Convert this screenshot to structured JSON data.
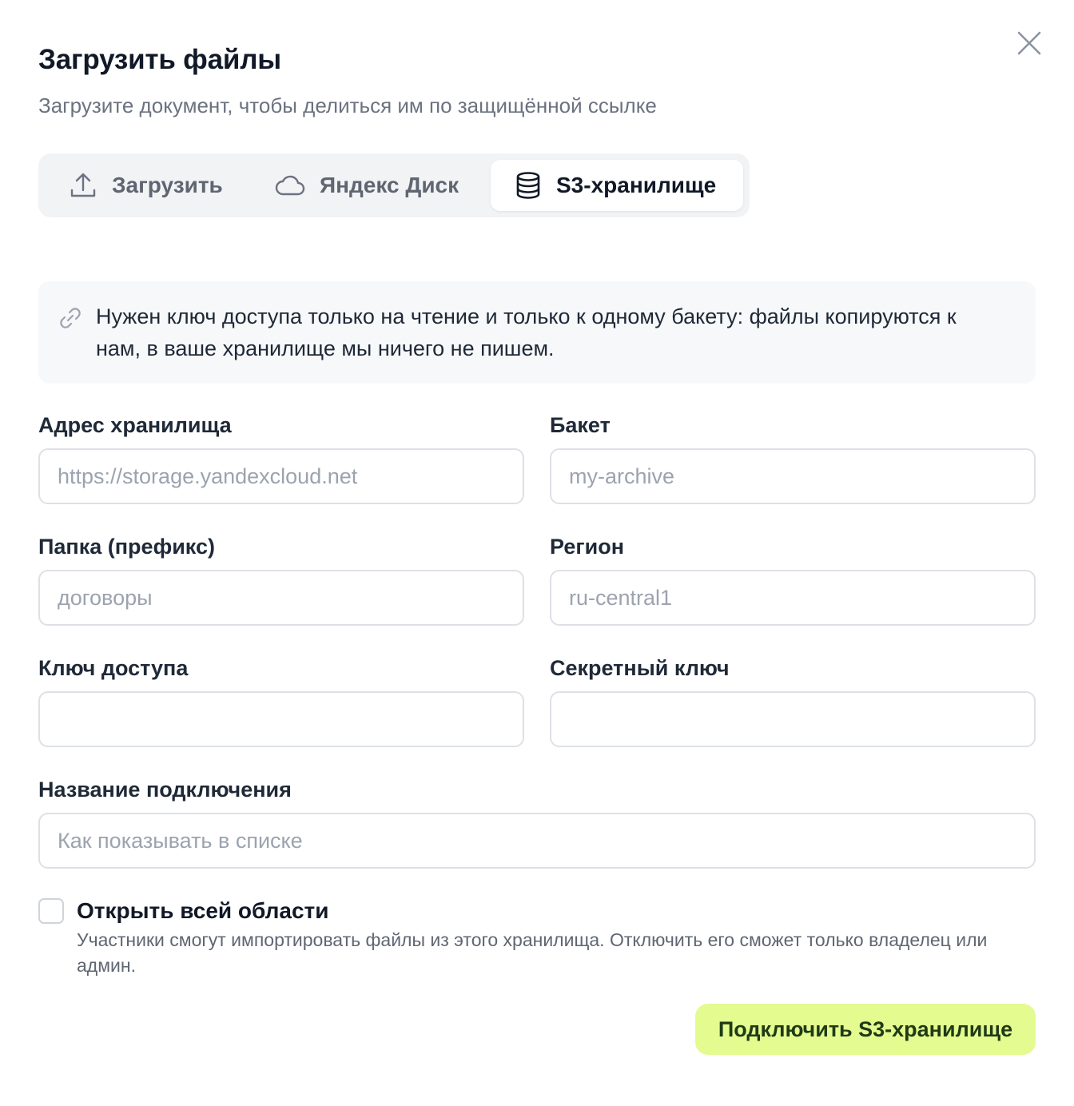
{
  "dialog": {
    "title": "Загрузить файлы",
    "subtitle": "Загрузите документ, чтобы делиться им по защищённой ссылке"
  },
  "tabs": [
    {
      "label": "Загрузить",
      "icon": "upload-icon",
      "active": false
    },
    {
      "label": "Яндекс Диск",
      "icon": "cloud-icon",
      "active": false
    },
    {
      "label": "S3-хранилище",
      "icon": "database-icon",
      "active": true
    }
  ],
  "info": {
    "icon": "link-icon",
    "text": "Нужен ключ доступа только на чтение и только к одному бакету: файлы копируются к нам, в ваше хранилище мы ничего не пишем."
  },
  "form": {
    "endpoint": {
      "label": "Адрес хранилища",
      "placeholder": "https://storage.yandexcloud.net",
      "value": ""
    },
    "bucket": {
      "label": "Бакет",
      "placeholder": "my-archive",
      "value": ""
    },
    "prefix": {
      "label": "Папка (префикс)",
      "placeholder": "договоры",
      "value": ""
    },
    "region": {
      "label": "Регион",
      "placeholder": "ru-central1",
      "value": ""
    },
    "access_key": {
      "label": "Ключ доступа",
      "placeholder": "",
      "value": ""
    },
    "secret_key": {
      "label": "Секретный ключ",
      "placeholder": "",
      "value": ""
    },
    "connection_name": {
      "label": "Название подключения",
      "placeholder": "Как показывать в списке",
      "value": ""
    }
  },
  "share": {
    "checked": false,
    "title": "Открыть всей области",
    "description": "Участники смогут импортировать файлы из этого хранилища. Отключить его сможет только владелец или админ."
  },
  "submit_label": "Подключить S3-хранилище",
  "colors": {
    "accent": "#e3fb8f",
    "accent_text": "#1f3a15",
    "muted_text": "#6b7280",
    "tab_bg": "#f1f3f5",
    "info_bg": "#f6f8fa"
  }
}
